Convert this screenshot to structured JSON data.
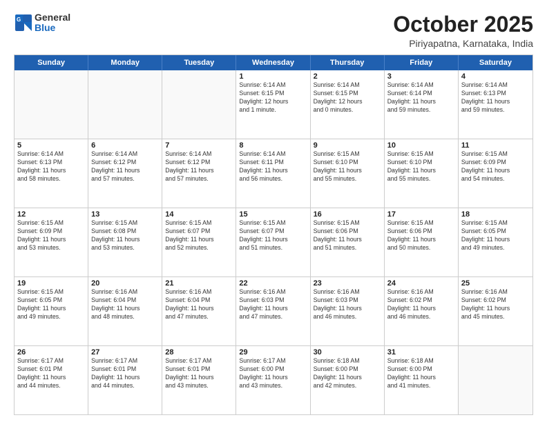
{
  "logo": {
    "line1": "General",
    "line2": "Blue"
  },
  "title": "October 2025",
  "subtitle": "Piriyapatna, Karnataka, India",
  "header_days": [
    "Sunday",
    "Monday",
    "Tuesday",
    "Wednesday",
    "Thursday",
    "Friday",
    "Saturday"
  ],
  "weeks": [
    [
      {
        "day": "",
        "info": ""
      },
      {
        "day": "",
        "info": ""
      },
      {
        "day": "",
        "info": ""
      },
      {
        "day": "1",
        "info": "Sunrise: 6:14 AM\nSunset: 6:15 PM\nDaylight: 12 hours\nand 1 minute."
      },
      {
        "day": "2",
        "info": "Sunrise: 6:14 AM\nSunset: 6:15 PM\nDaylight: 12 hours\nand 0 minutes."
      },
      {
        "day": "3",
        "info": "Sunrise: 6:14 AM\nSunset: 6:14 PM\nDaylight: 11 hours\nand 59 minutes."
      },
      {
        "day": "4",
        "info": "Sunrise: 6:14 AM\nSunset: 6:13 PM\nDaylight: 11 hours\nand 59 minutes."
      }
    ],
    [
      {
        "day": "5",
        "info": "Sunrise: 6:14 AM\nSunset: 6:13 PM\nDaylight: 11 hours\nand 58 minutes."
      },
      {
        "day": "6",
        "info": "Sunrise: 6:14 AM\nSunset: 6:12 PM\nDaylight: 11 hours\nand 57 minutes."
      },
      {
        "day": "7",
        "info": "Sunrise: 6:14 AM\nSunset: 6:12 PM\nDaylight: 11 hours\nand 57 minutes."
      },
      {
        "day": "8",
        "info": "Sunrise: 6:14 AM\nSunset: 6:11 PM\nDaylight: 11 hours\nand 56 minutes."
      },
      {
        "day": "9",
        "info": "Sunrise: 6:15 AM\nSunset: 6:10 PM\nDaylight: 11 hours\nand 55 minutes."
      },
      {
        "day": "10",
        "info": "Sunrise: 6:15 AM\nSunset: 6:10 PM\nDaylight: 11 hours\nand 55 minutes."
      },
      {
        "day": "11",
        "info": "Sunrise: 6:15 AM\nSunset: 6:09 PM\nDaylight: 11 hours\nand 54 minutes."
      }
    ],
    [
      {
        "day": "12",
        "info": "Sunrise: 6:15 AM\nSunset: 6:09 PM\nDaylight: 11 hours\nand 53 minutes."
      },
      {
        "day": "13",
        "info": "Sunrise: 6:15 AM\nSunset: 6:08 PM\nDaylight: 11 hours\nand 53 minutes."
      },
      {
        "day": "14",
        "info": "Sunrise: 6:15 AM\nSunset: 6:07 PM\nDaylight: 11 hours\nand 52 minutes."
      },
      {
        "day": "15",
        "info": "Sunrise: 6:15 AM\nSunset: 6:07 PM\nDaylight: 11 hours\nand 51 minutes."
      },
      {
        "day": "16",
        "info": "Sunrise: 6:15 AM\nSunset: 6:06 PM\nDaylight: 11 hours\nand 51 minutes."
      },
      {
        "day": "17",
        "info": "Sunrise: 6:15 AM\nSunset: 6:06 PM\nDaylight: 11 hours\nand 50 minutes."
      },
      {
        "day": "18",
        "info": "Sunrise: 6:15 AM\nSunset: 6:05 PM\nDaylight: 11 hours\nand 49 minutes."
      }
    ],
    [
      {
        "day": "19",
        "info": "Sunrise: 6:15 AM\nSunset: 6:05 PM\nDaylight: 11 hours\nand 49 minutes."
      },
      {
        "day": "20",
        "info": "Sunrise: 6:16 AM\nSunset: 6:04 PM\nDaylight: 11 hours\nand 48 minutes."
      },
      {
        "day": "21",
        "info": "Sunrise: 6:16 AM\nSunset: 6:04 PM\nDaylight: 11 hours\nand 47 minutes."
      },
      {
        "day": "22",
        "info": "Sunrise: 6:16 AM\nSunset: 6:03 PM\nDaylight: 11 hours\nand 47 minutes."
      },
      {
        "day": "23",
        "info": "Sunrise: 6:16 AM\nSunset: 6:03 PM\nDaylight: 11 hours\nand 46 minutes."
      },
      {
        "day": "24",
        "info": "Sunrise: 6:16 AM\nSunset: 6:02 PM\nDaylight: 11 hours\nand 46 minutes."
      },
      {
        "day": "25",
        "info": "Sunrise: 6:16 AM\nSunset: 6:02 PM\nDaylight: 11 hours\nand 45 minutes."
      }
    ],
    [
      {
        "day": "26",
        "info": "Sunrise: 6:17 AM\nSunset: 6:01 PM\nDaylight: 11 hours\nand 44 minutes."
      },
      {
        "day": "27",
        "info": "Sunrise: 6:17 AM\nSunset: 6:01 PM\nDaylight: 11 hours\nand 44 minutes."
      },
      {
        "day": "28",
        "info": "Sunrise: 6:17 AM\nSunset: 6:01 PM\nDaylight: 11 hours\nand 43 minutes."
      },
      {
        "day": "29",
        "info": "Sunrise: 6:17 AM\nSunset: 6:00 PM\nDaylight: 11 hours\nand 43 minutes."
      },
      {
        "day": "30",
        "info": "Sunrise: 6:18 AM\nSunset: 6:00 PM\nDaylight: 11 hours\nand 42 minutes."
      },
      {
        "day": "31",
        "info": "Sunrise: 6:18 AM\nSunset: 6:00 PM\nDaylight: 11 hours\nand 41 minutes."
      },
      {
        "day": "",
        "info": ""
      }
    ]
  ]
}
